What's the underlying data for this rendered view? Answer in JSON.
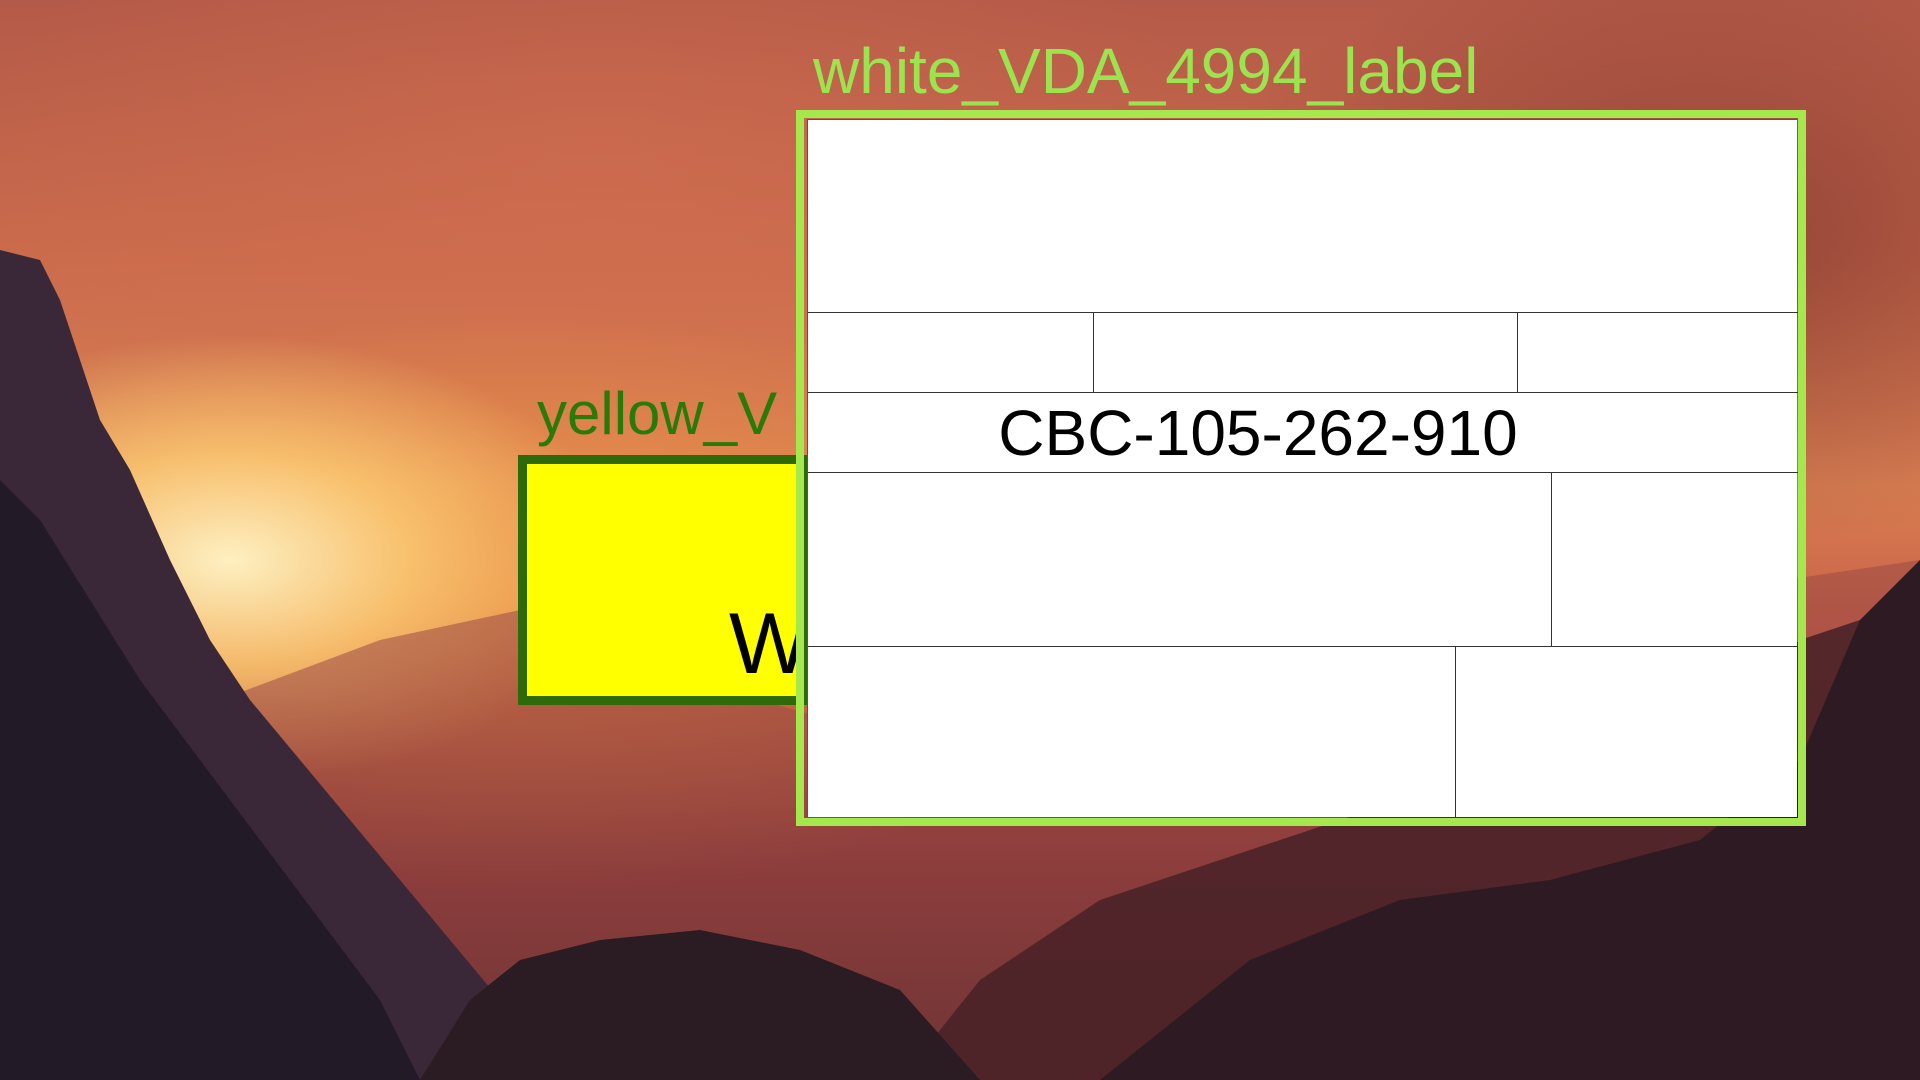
{
  "desktop": {
    "wallpaper_name": "sunset-mountain-valley"
  },
  "yellow_label": {
    "title": "yellow_V",
    "visible_text": "W",
    "background_color": "#ffff00",
    "border_color": "#2f6a0a",
    "title_color": "#2a7a0a"
  },
  "white_label": {
    "title": "white_VDA_4994_label",
    "serial": "CBC-105-262-910",
    "background_color": "#ffffff",
    "border_color": "#a4e84e",
    "title_color": "#9be34f"
  }
}
